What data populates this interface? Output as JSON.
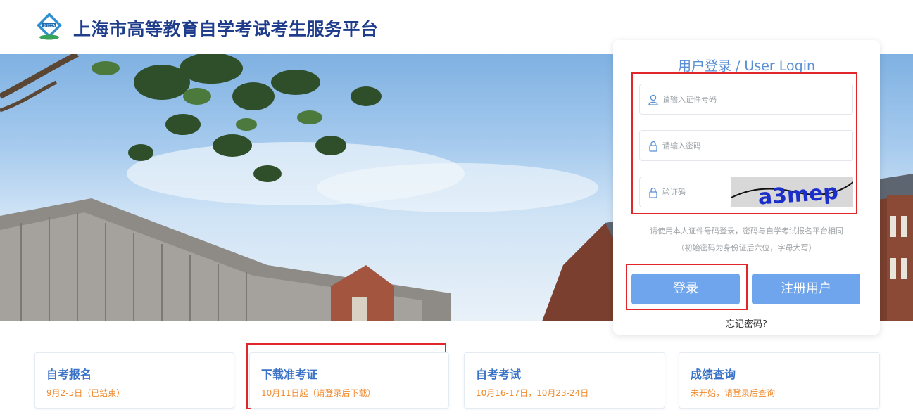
{
  "header": {
    "site_title": "上海市高等教育自学考试考生服务平台",
    "logo_text": "SHEEA"
  },
  "login": {
    "title": "用户登录 / User Login",
    "id_placeholder": "请输入证件号码",
    "password_placeholder": "请输入密码",
    "captcha_placeholder": "验证码",
    "captcha_text": "a3mep",
    "hint_line1": "请使用本人证件号码登录，密码与自学考试报名平台相同",
    "hint_line2": "（初始密码为身份证后六位，字母大写）",
    "login_button": "登录",
    "register_button": "注册用户",
    "forgot_link": "忘记密码?"
  },
  "cards": [
    {
      "title": "自考报名",
      "subtitle": "9月2-5日（已结束）"
    },
    {
      "title": "下载准考证",
      "subtitle": "10月11日起（请登录后下载）"
    },
    {
      "title": "自考考试",
      "subtitle": "10月16-17日，10月23-24日"
    },
    {
      "title": "成绩查询",
      "subtitle": "未开始，请登录后查询"
    }
  ],
  "colors": {
    "title_blue": "#1f3d8a",
    "accent_blue": "#5b8fd4",
    "button_blue": "#6ea5ec",
    "card_title": "#3a72c7",
    "card_sub_orange": "#f08a2e",
    "highlight_red": "#e0262b"
  }
}
